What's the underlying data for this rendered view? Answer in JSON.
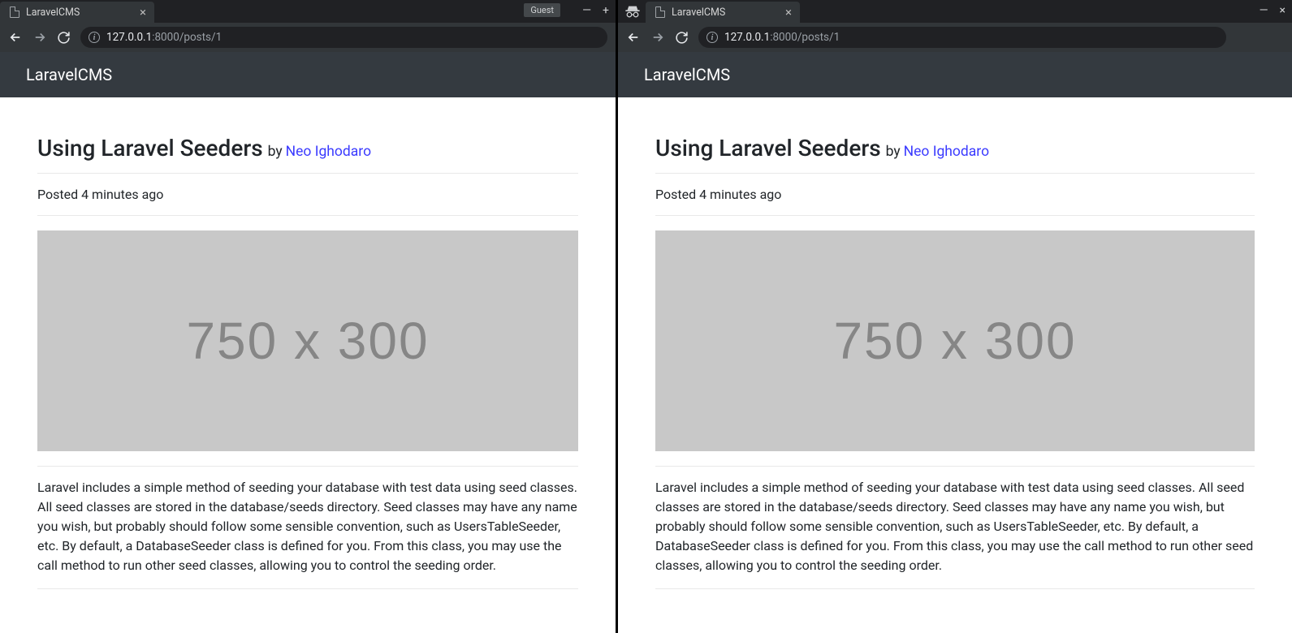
{
  "browser": {
    "tab_title": "LaravelCMS",
    "url_host": "127.0.0.1",
    "url_path": ":8000/posts/1",
    "guest_label": "Guest"
  },
  "navbar": {
    "brand": "LaravelCMS"
  },
  "post": {
    "title": "Using Laravel Seeders",
    "by_label": "by",
    "author": "Neo Ighodaro",
    "posted": "Posted 4 minutes ago",
    "placeholder_text": "750 x 300",
    "body": "Laravel includes a simple method of seeding your database with test data using seed classes. All seed classes are stored in the database/seeds directory. Seed classes may have any name you wish, but probably should follow some sensible convention, such as UsersTableSeeder, etc. By default, a DatabaseSeeder class is defined for you. From this class, you may use the call method to run other seed classes, allowing you to control the seeding order."
  }
}
